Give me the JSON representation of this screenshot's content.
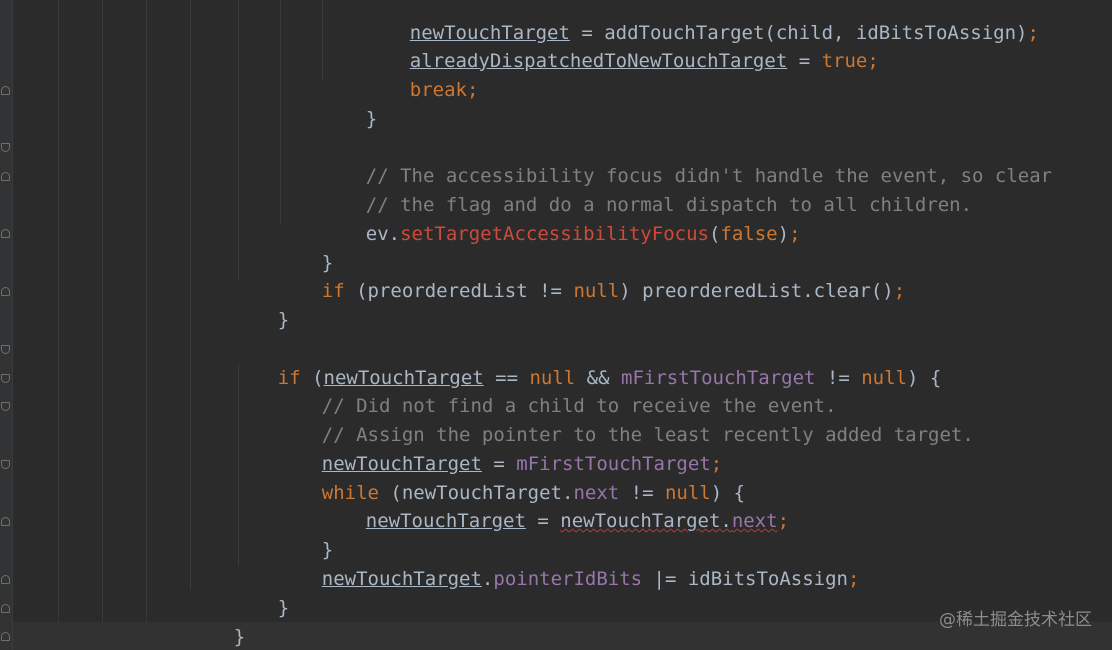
{
  "editor": {
    "lines": [
      {
        "t1": "newTouchTarget",
        "t2": " = addTouchTarget(child, idBitsToAssign)",
        "t3": ";"
      },
      {
        "t1": "alreadyDispatchedToNewTouchTarget",
        "t2": " = ",
        "t3": "true",
        "t4": ";"
      },
      {
        "t1": "break",
        "t2": ";"
      },
      {
        "t1": "}"
      },
      {
        "t1": ""
      },
      {
        "t1": "// The accessibility focus didn't handle the event, so clear"
      },
      {
        "t1": "// the flag and do a normal dispatch to all children."
      },
      {
        "t1": "ev.",
        "t2": "setTargetAccessibilityFocus",
        "t3": "(",
        "t4": "false",
        "t5": ")",
        "t6": ";"
      },
      {
        "t1": "}"
      },
      {
        "t1": "if",
        "t2": " (preorderedList != ",
        "t3": "null",
        "t4": ") preorderedList.clear()",
        "t5": ";"
      },
      {
        "t1": "}"
      },
      {
        "t1": ""
      },
      {
        "t1": "if",
        "t2": " (",
        "t3": "newTouchTarget",
        "t4": " == ",
        "t5": "null",
        "t6": " && ",
        "t7": "mFirstTouchTarget",
        "t8": " != ",
        "t9": "null",
        "t10": ") {"
      },
      {
        "t1": "// Did not find a child to receive the event."
      },
      {
        "t1": "// Assign the pointer to the least recently added target."
      },
      {
        "t1": "newTouchTarget",
        "t2": " = ",
        "t3": "mFirstTouchTarget",
        "t4": ";"
      },
      {
        "t1": "while",
        "t2": " (newTouchTarget.",
        "t3": "next",
        "t4": " != ",
        "t5": "null",
        "t6": ") {"
      },
      {
        "t1": "newTouchTarget",
        "t2": " = ",
        "t3": "newTouchTarget.",
        "t4": "next",
        "t5": ";"
      },
      {
        "t1": "}"
      },
      {
        "t1": "newTouchTarget",
        "t2": ".",
        "t3": "pointerIdBits",
        "t4": " |= idBitsToAssign",
        "t5": ";"
      },
      {
        "t1": "}"
      },
      {
        "t1": "}"
      },
      {
        "t1": "}"
      }
    ]
  },
  "watermark": "@稀土掘金技术社区",
  "colors": {
    "background": "#2b2b2b",
    "keyword": "#cc7832",
    "comment": "#808080",
    "field": "#9876aa",
    "method_error": "#d04a3a",
    "text": "#a9b7c6",
    "brace_match": "#ffef28"
  }
}
